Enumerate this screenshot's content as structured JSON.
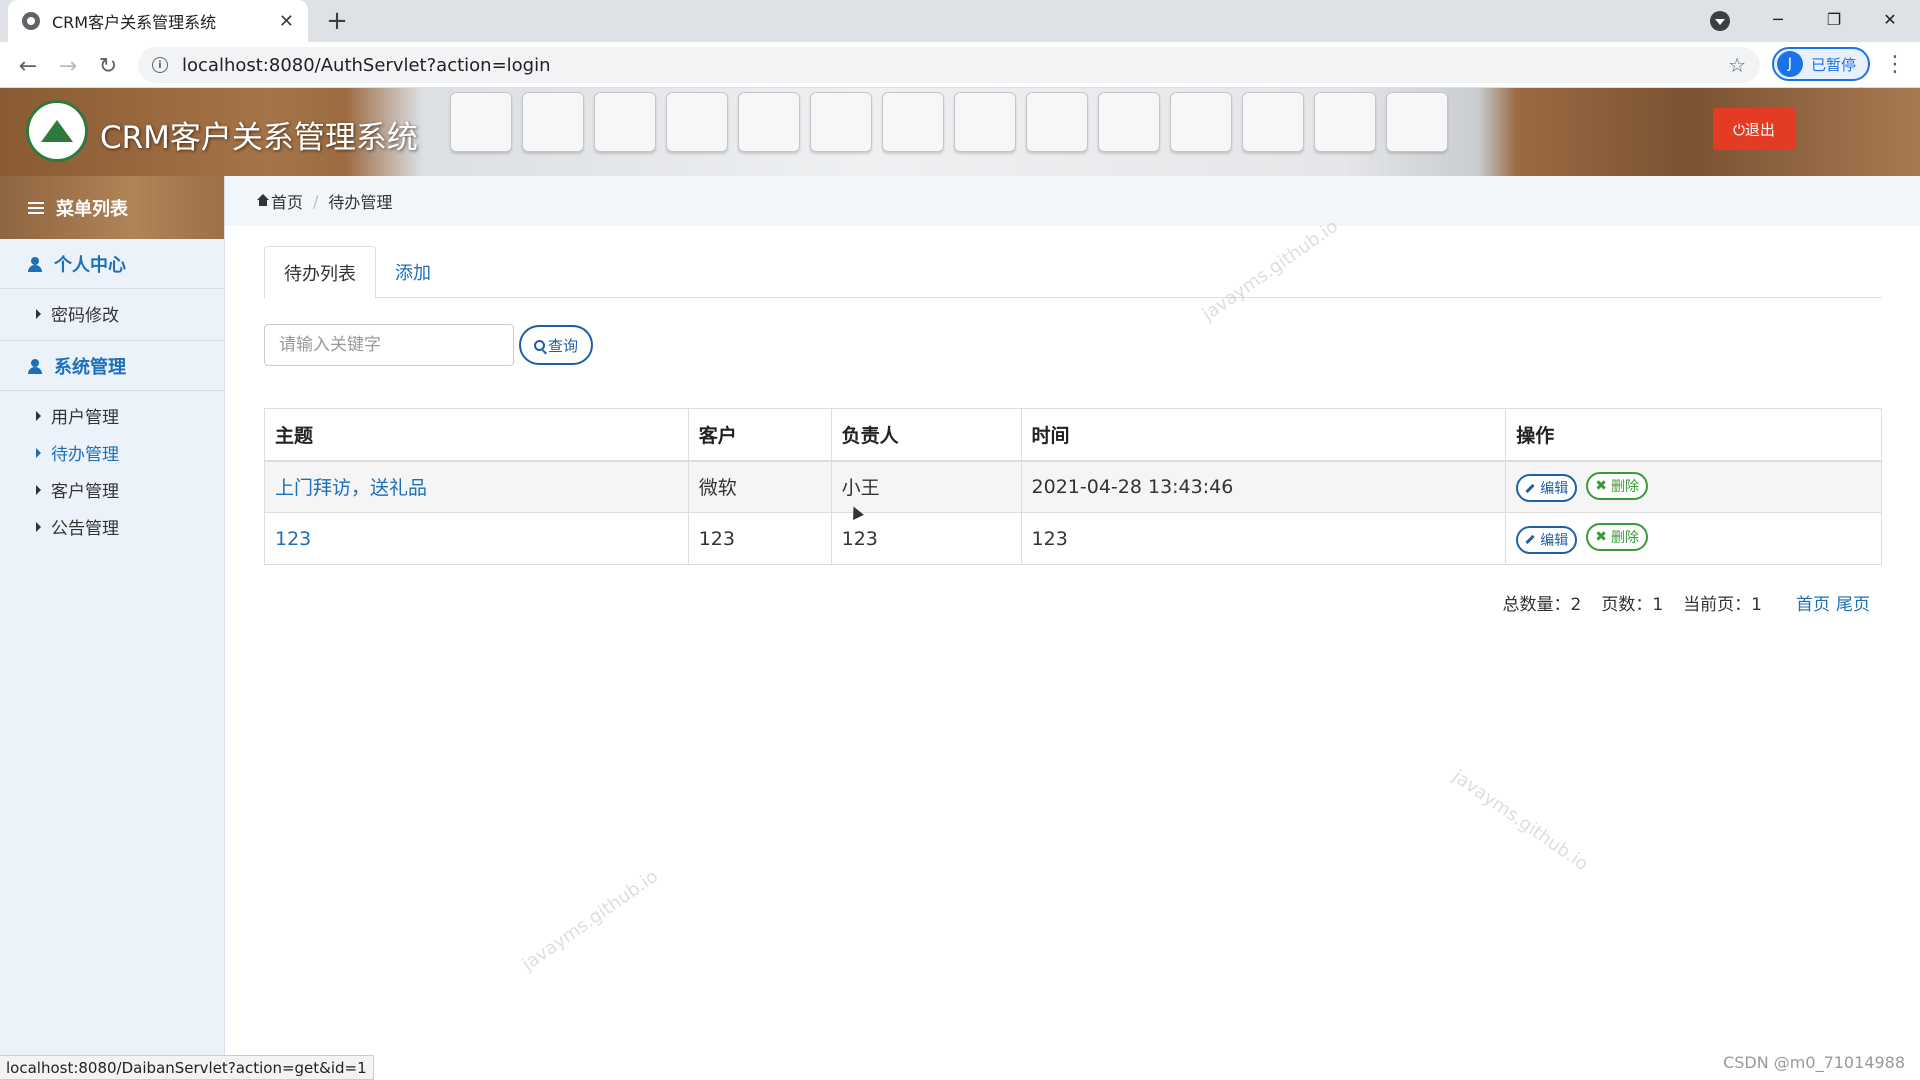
{
  "browser": {
    "tab_title": "CRM客户关系管理系统",
    "tab_close": "✕",
    "new_tab": "+",
    "url": "localhost:8080/AuthServlet?action=login",
    "profile_initial": "J",
    "profile_label": "已暂停",
    "status_url": "localhost:8080/DaibanServlet?action=get&id=1"
  },
  "header": {
    "app_title": "CRM客户关系管理系统",
    "logout_label": "⏻退出"
  },
  "sidebar": {
    "title": "菜单列表",
    "sections": [
      {
        "label": "个人中心",
        "items": [
          "密码修改"
        ]
      },
      {
        "label": "系统管理",
        "items": [
          "用户管理",
          "待办管理",
          "客户管理",
          "公告管理"
        ]
      }
    ],
    "active_item": "待办管理"
  },
  "breadcrumb": {
    "home": "首页",
    "current": "待办管理"
  },
  "tabs": {
    "list": "待办列表",
    "add": "添加"
  },
  "search": {
    "placeholder": "请输入关键字",
    "button": "查询"
  },
  "table": {
    "headers": [
      "主题",
      "客户",
      "负责人",
      "时间",
      "操作"
    ],
    "rows": [
      {
        "subject": "上门拜访，送礼品",
        "customer": "微软",
        "owner": "小王",
        "time": "2021-04-28 13:43:46"
      },
      {
        "subject": "123",
        "customer": "123",
        "owner": "123",
        "time": "123"
      }
    ],
    "edit_label": "编辑",
    "delete_label": "删除"
  },
  "pager": {
    "total": "总数量：2",
    "pages": "页数：1",
    "current": "当前页：1",
    "first": "首页",
    "last": "尾页"
  },
  "watermark_text": "javayms.github.io",
  "credit": "CSDN @m0_71014988",
  "colors": {
    "accent": "#1d6fb8",
    "logout": "#e43b25",
    "delete": "#3a9a3a"
  }
}
